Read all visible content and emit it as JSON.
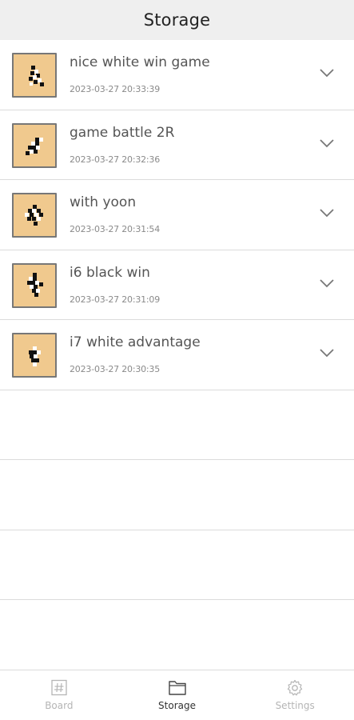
{
  "header": {
    "title": "Storage"
  },
  "games": [
    {
      "title": "nice white win game",
      "date": "2023-03-27 20:33:39",
      "thumb_icon": "board-thumbnail"
    },
    {
      "title": "game battle 2R",
      "date": "2023-03-27 20:32:36",
      "thumb_icon": "board-thumbnail"
    },
    {
      "title": "with yoon",
      "date": "2023-03-27 20:31:54",
      "thumb_icon": "board-thumbnail"
    },
    {
      "title": "i6 black win",
      "date": "2023-03-27 20:31:09",
      "thumb_icon": "board-thumbnail"
    },
    {
      "title": "i7 white advantage",
      "date": "2023-03-27 20:30:35",
      "thumb_icon": "board-thumbnail"
    }
  ],
  "tabs": [
    {
      "label": "Board",
      "icon": "board-grid-icon",
      "active": false
    },
    {
      "label": "Storage",
      "icon": "folder-icon",
      "active": true
    },
    {
      "label": "Settings",
      "icon": "gear-icon",
      "active": false
    }
  ],
  "colors": {
    "header_bg": "#efefef",
    "board_wood": "#f0c98e",
    "divider": "#dcdcdc",
    "active_tab": "#333333",
    "inactive_tab": "#b5b5b5"
  }
}
